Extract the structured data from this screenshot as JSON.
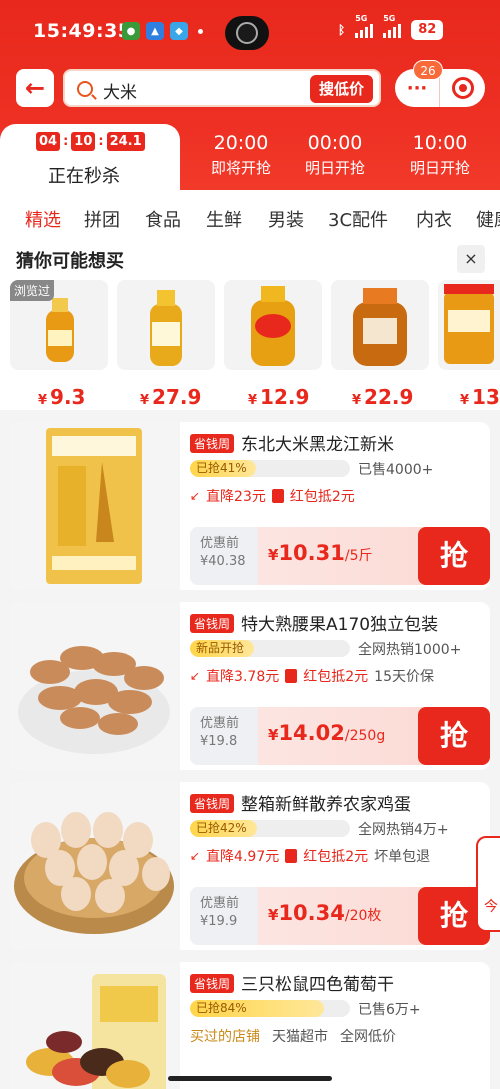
{
  "status": {
    "time": "15:49:35",
    "net1": "5G",
    "net2": "5G",
    "battery": "82"
  },
  "search": {
    "query": "大米",
    "button": "搜低价"
  },
  "capsule": {
    "badge": "26",
    "more": "···"
  },
  "sessions": {
    "active": {
      "h": "04",
      "m": "10",
      "s": "24.1",
      "label": "正在秒杀"
    },
    "upcoming": [
      {
        "time": "20:00",
        "label": "即将开抢"
      },
      {
        "time": "00:00",
        "label": "明日开抢"
      },
      {
        "time": "10:00",
        "label": "明日开抢"
      }
    ]
  },
  "categories": [
    "精选",
    "拼团",
    "食品",
    "生鲜",
    "男装",
    "3C配件",
    "内衣",
    "健康"
  ],
  "recommend": {
    "title": "猜你可能想买",
    "close": "×",
    "viewed": "浏览过",
    "items": [
      {
        "price": "9.3"
      },
      {
        "price": "27.9"
      },
      {
        "price": "12.9"
      },
      {
        "price": "22.9"
      },
      {
        "price": "13"
      }
    ],
    "currency": "¥"
  },
  "products": [
    {
      "tag": "省钱周",
      "title": "东北大米黑龙江新米",
      "progress_label": "已抢41%",
      "progress": 0.41,
      "sold": "已售4000+",
      "perk1": "直降23元",
      "perk2": "红包抵2元",
      "perk3": "",
      "before_label": "优惠前",
      "before": "¥40.38",
      "price": "10.31",
      "unit": "/5斤",
      "grab": "抢"
    },
    {
      "tag": "省钱周",
      "title": "特大熟腰果A170独立包装",
      "progress_label": "新品开抢",
      "progress": 0.0,
      "sold": "全网热销1000+",
      "perk1": "直降3.78元",
      "perk2": "红包抵2元",
      "perk3": "15天价保",
      "before_label": "优惠前",
      "before": "¥19.8",
      "price": "14.02",
      "unit": "/250g",
      "grab": "抢"
    },
    {
      "tag": "省钱周",
      "title": "整箱新鲜散养农家鸡蛋",
      "progress_label": "已抢42%",
      "progress": 0.42,
      "sold": "全网热销4万+",
      "perk1": "直降4.97元",
      "perk2": "红包抵2元",
      "perk3": "坏单包退",
      "before_label": "优惠前",
      "before": "¥19.9",
      "price": "10.34",
      "unit": "/20枚",
      "grab": "抢"
    },
    {
      "tag": "省钱周",
      "title": "三只松鼠四色葡萄干",
      "progress_label": "已抢84%",
      "progress": 0.84,
      "sold": "已售6万+",
      "link1": "买过的店铺",
      "link2": "天猫超市",
      "link3": "全网低价"
    }
  ],
  "floating": "今",
  "colors": {
    "brand": "#e8281c",
    "progress": "#ffd54a"
  }
}
